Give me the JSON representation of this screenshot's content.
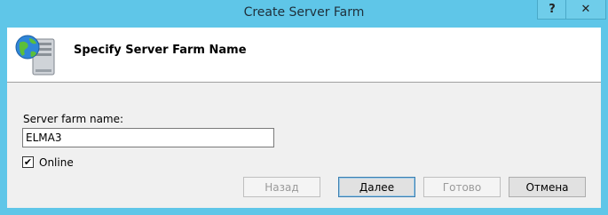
{
  "window": {
    "title": "Create Server Farm"
  },
  "titlebar": {
    "help_label": "?",
    "close_label": "✕"
  },
  "header": {
    "title": "Specify Server Farm Name",
    "icon": "server-globe-icon"
  },
  "form": {
    "name_label": "Server farm name:",
    "name_value": "ELMA3",
    "online_checked": true,
    "online_label": "Online"
  },
  "buttons": {
    "back": "Назад",
    "next": "Далее",
    "finish": "Готово",
    "cancel": "Отмена"
  }
}
